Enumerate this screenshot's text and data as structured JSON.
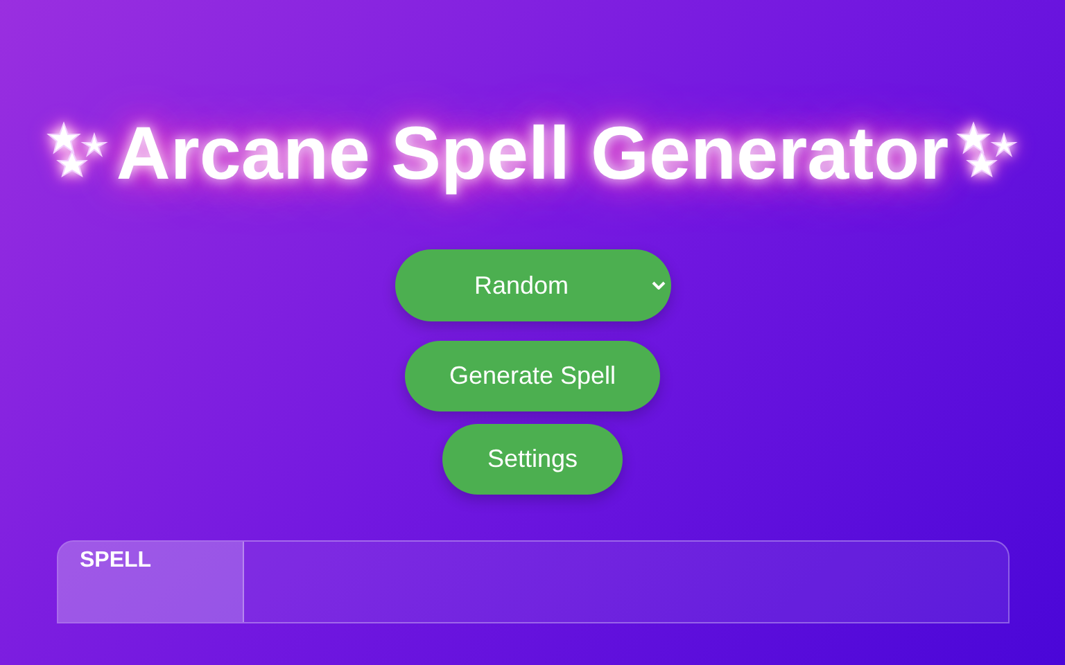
{
  "title": "Arcane Spell Generator",
  "spell_type_select": {
    "value": "Random"
  },
  "buttons": [
    "Generate Spell",
    "Settings"
  ],
  "table": {
    "header": "SPELL"
  }
}
